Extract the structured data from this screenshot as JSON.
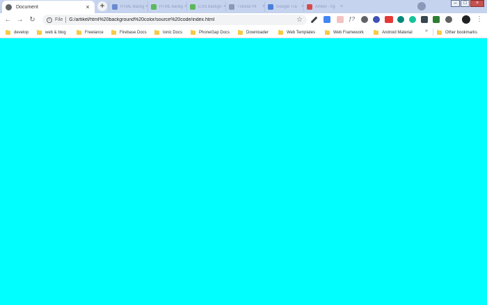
{
  "window": {
    "active_tab_title": "Document",
    "tab_close_glyph": "×",
    "new_tab_glyph": "+",
    "minimize_glyph": "–",
    "maximize_glyph": "□",
    "close_glyph": "×"
  },
  "background_tabs": [
    {
      "label": "HTML Backgr",
      "icon_color": "#6a8ad0"
    },
    {
      "label": "HTML backgr",
      "icon_color": "#5cb85c"
    },
    {
      "label": "CSS backgrou",
      "icon_color": "#5cb85c"
    },
    {
      "label": "Tutorial Ht",
      "icon_color": "#8a99b8"
    },
    {
      "label": "Google Tra",
      "icon_color": "#4a7fd8"
    },
    {
      "label": "Artikel - t/g",
      "icon_color": "#d84a4a"
    }
  ],
  "toolbar": {
    "back_glyph": "←",
    "forward_glyph": "→",
    "reload_glyph": "↻",
    "info_glyph": "i",
    "scheme_label": "File",
    "url": "G:/artikel/html%20background%20color/source%20code/index.html",
    "bookmark_star_glyph": "☆",
    "menu_glyph": "⋮",
    "extension_icons": [
      {
        "name": "eyedropper-icon",
        "color": "#3c4043"
      },
      {
        "name": "translate-icon",
        "color": "#4285f4"
      },
      {
        "name": "sticky-icon",
        "color": "#f4c2c2"
      },
      {
        "name": "f-question-icon",
        "color": "#5f6368"
      },
      {
        "name": "gear-icon",
        "color": "#5f6368"
      },
      {
        "name": "blue-circle-icon",
        "color": "#3f51b5"
      },
      {
        "name": "new-badge-icon",
        "color": "#e53935"
      },
      {
        "name": "teal-circle-icon",
        "color": "#00897b"
      },
      {
        "name": "grammarly-icon",
        "color": "#15c39a"
      },
      {
        "name": "square-icon",
        "color": "#37474f"
      },
      {
        "name": "green-square-icon",
        "color": "#2e7d32"
      },
      {
        "name": "clock-icon",
        "color": "#616161"
      },
      {
        "name": "profile-icon",
        "color": "#202124"
      }
    ]
  },
  "bookmarks": [
    "develop",
    "web & blog",
    "Freelance",
    "Firebase Docs",
    "Ionic Docs",
    "PhoneGap Docs",
    "Downloader",
    "Web Templates",
    "Web Framework",
    "Android Material"
  ],
  "bookmarks_overflow_glyph": "»",
  "other_bookmarks_label": "Other bookmarks",
  "page": {
    "background_color": "#00ffff"
  }
}
